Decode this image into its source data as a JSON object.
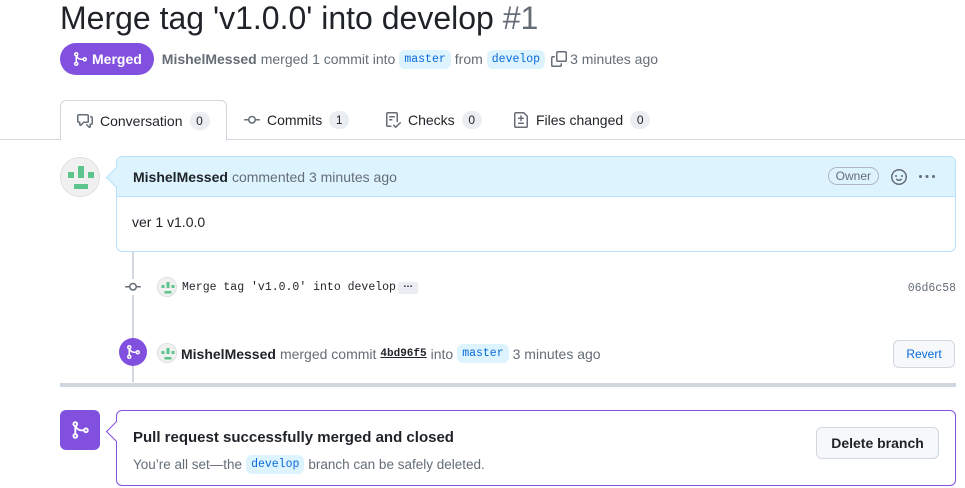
{
  "pr": {
    "title": "Merge tag 'v1.0.0' into develop",
    "number": "#1",
    "state": "Merged",
    "author": "MishelMessed",
    "summary_merged": "merged 1 commit into",
    "base_branch": "master",
    "from_word": "from",
    "head_branch": "develop",
    "time": "3 minutes ago"
  },
  "tabs": [
    {
      "label": "Conversation",
      "count": "0",
      "icon": "comment-discussion-icon"
    },
    {
      "label": "Commits",
      "count": "1",
      "icon": "git-commit-icon"
    },
    {
      "label": "Checks",
      "count": "0",
      "icon": "checklist-icon"
    },
    {
      "label": "Files changed",
      "count": "0",
      "icon": "file-diff-icon"
    }
  ],
  "comment": {
    "author": "MishelMessed",
    "action": "commented 3 minutes ago",
    "role_badge": "Owner",
    "body": "ver 1 v1.0.0"
  },
  "commit": {
    "message": "Merge tag 'v1.0.0' into develop",
    "expand": "…",
    "sha": "06d6c58"
  },
  "merge_event": {
    "author": "MishelMessed",
    "action": "merged commit",
    "commit": "4bd96f5",
    "into_word": "into",
    "branch": "master",
    "time": "3 minutes ago",
    "revert_label": "Revert"
  },
  "merged_box": {
    "title": "Pull request successfully merged and closed",
    "sub_before": "You’re all set—the",
    "branch": "develop",
    "sub_after": "branch can be safely deleted.",
    "delete_label": "Delete branch"
  },
  "colors": {
    "merged": "#8250df",
    "accent": "#0969da",
    "header_bg": "#ddf4ff"
  }
}
